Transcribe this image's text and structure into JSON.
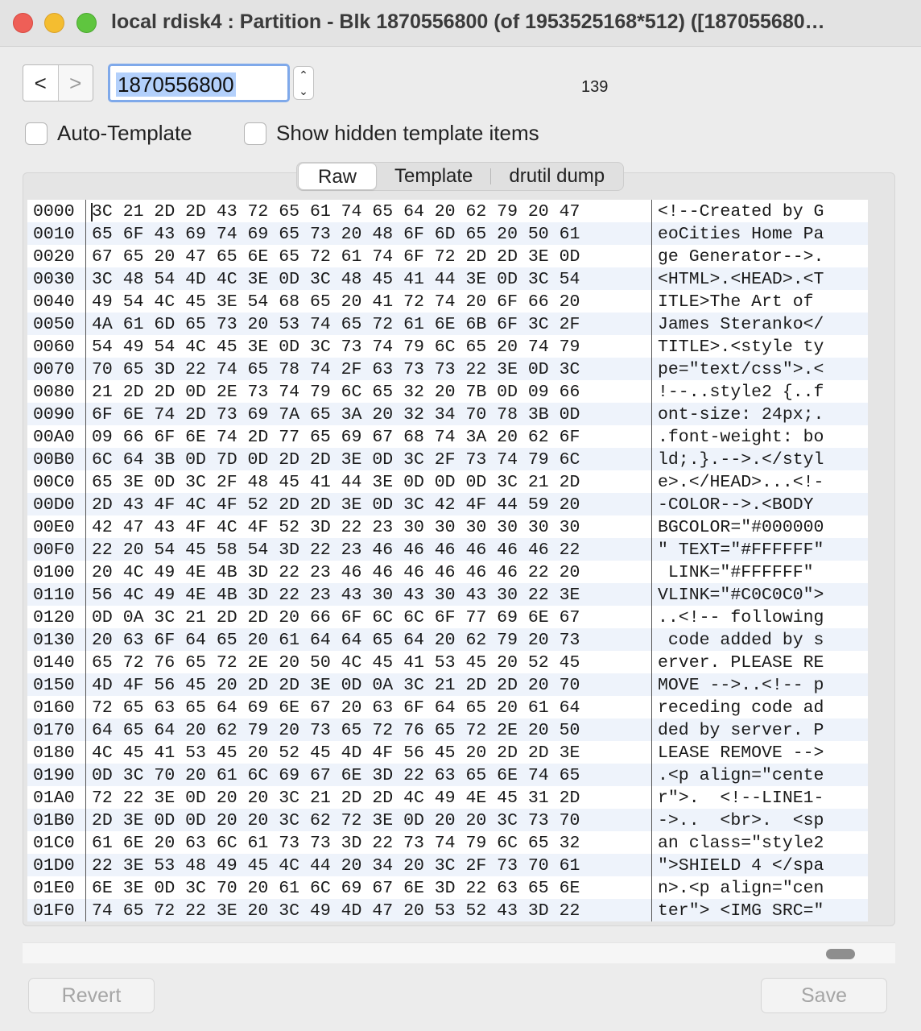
{
  "window": {
    "title": "local rdisk4 : Partition - Blk 1870556800 (of 1953525168*512) ([187055680…"
  },
  "toolbar": {
    "prev_label": "<",
    "next_label": ">",
    "block_value": "1870556800",
    "stepper_up": "⌃",
    "stepper_down": "⌄",
    "count": "139"
  },
  "options": {
    "auto_template": "Auto-Template",
    "show_hidden": "Show hidden template items"
  },
  "tabs": [
    {
      "label": "Raw",
      "active": true
    },
    {
      "label": "Template",
      "active": false
    },
    {
      "label": "drutil dump",
      "active": false
    }
  ],
  "hex_rows": [
    {
      "offset": "0000",
      "bytes": "3C 21 2D 2D 43 72 65 61 74 65 64 20 62 79 20 47",
      "ascii": "<!--Created by G"
    },
    {
      "offset": "0010",
      "bytes": "65 6F 43 69 74 69 65 73 20 48 6F 6D 65 20 50 61",
      "ascii": "eoCities Home Pa"
    },
    {
      "offset": "0020",
      "bytes": "67 65 20 47 65 6E 65 72 61 74 6F 72 2D 2D 3E 0D",
      "ascii": "ge Generator-->."
    },
    {
      "offset": "0030",
      "bytes": "3C 48 54 4D 4C 3E 0D 3C 48 45 41 44 3E 0D 3C 54",
      "ascii": "<HTML>.<HEAD>.<T"
    },
    {
      "offset": "0040",
      "bytes": "49 54 4C 45 3E 54 68 65 20 41 72 74 20 6F 66 20",
      "ascii": "ITLE>The Art of "
    },
    {
      "offset": "0050",
      "bytes": "4A 61 6D 65 73 20 53 74 65 72 61 6E 6B 6F 3C 2F",
      "ascii": "James Steranko</"
    },
    {
      "offset": "0060",
      "bytes": "54 49 54 4C 45 3E 0D 3C 73 74 79 6C 65 20 74 79",
      "ascii": "TITLE>.<style ty"
    },
    {
      "offset": "0070",
      "bytes": "70 65 3D 22 74 65 78 74 2F 63 73 73 22 3E 0D 3C",
      "ascii": "pe=\"text/css\">.<"
    },
    {
      "offset": "0080",
      "bytes": "21 2D 2D 0D 2E 73 74 79 6C 65 32 20 7B 0D 09 66",
      "ascii": "!--..style2 {..f"
    },
    {
      "offset": "0090",
      "bytes": "6F 6E 74 2D 73 69 7A 65 3A 20 32 34 70 78 3B 0D",
      "ascii": "ont-size: 24px;."
    },
    {
      "offset": "00A0",
      "bytes": "09 66 6F 6E 74 2D 77 65 69 67 68 74 3A 20 62 6F",
      "ascii": ".font-weight: bo"
    },
    {
      "offset": "00B0",
      "bytes": "6C 64 3B 0D 7D 0D 2D 2D 3E 0D 3C 2F 73 74 79 6C",
      "ascii": "ld;.}.-->.</styl"
    },
    {
      "offset": "00C0",
      "bytes": "65 3E 0D 3C 2F 48 45 41 44 3E 0D 0D 0D 3C 21 2D",
      "ascii": "e>.</HEAD>...<!-"
    },
    {
      "offset": "00D0",
      "bytes": "2D 43 4F 4C 4F 52 2D 2D 3E 0D 3C 42 4F 44 59 20",
      "ascii": "-COLOR-->.<BODY "
    },
    {
      "offset": "00E0",
      "bytes": "42 47 43 4F 4C 4F 52 3D 22 23 30 30 30 30 30 30",
      "ascii": "BGCOLOR=\"#000000"
    },
    {
      "offset": "00F0",
      "bytes": "22 20 54 45 58 54 3D 22 23 46 46 46 46 46 46 22",
      "ascii": "\" TEXT=\"#FFFFFF\""
    },
    {
      "offset": "0100",
      "bytes": "20 4C 49 4E 4B 3D 22 23 46 46 46 46 46 46 22 20",
      "ascii": " LINK=\"#FFFFFF\" "
    },
    {
      "offset": "0110",
      "bytes": "56 4C 49 4E 4B 3D 22 23 43 30 43 30 43 30 22 3E",
      "ascii": "VLINK=\"#C0C0C0\">"
    },
    {
      "offset": "0120",
      "bytes": "0D 0A 3C 21 2D 2D 20 66 6F 6C 6C 6F 77 69 6E 67",
      "ascii": "..<!-- following"
    },
    {
      "offset": "0130",
      "bytes": "20 63 6F 64 65 20 61 64 64 65 64 20 62 79 20 73",
      "ascii": " code added by s"
    },
    {
      "offset": "0140",
      "bytes": "65 72 76 65 72 2E 20 50 4C 45 41 53 45 20 52 45",
      "ascii": "erver. PLEASE RE"
    },
    {
      "offset": "0150",
      "bytes": "4D 4F 56 45 20 2D 2D 3E 0D 0A 3C 21 2D 2D 20 70",
      "ascii": "MOVE -->..<!-- p"
    },
    {
      "offset": "0160",
      "bytes": "72 65 63 65 64 69 6E 67 20 63 6F 64 65 20 61 64",
      "ascii": "receding code ad"
    },
    {
      "offset": "0170",
      "bytes": "64 65 64 20 62 79 20 73 65 72 76 65 72 2E 20 50",
      "ascii": "ded by server. P"
    },
    {
      "offset": "0180",
      "bytes": "4C 45 41 53 45 20 52 45 4D 4F 56 45 20 2D 2D 3E",
      "ascii": "LEASE REMOVE -->"
    },
    {
      "offset": "0190",
      "bytes": "0D 3C 70 20 61 6C 69 67 6E 3D 22 63 65 6E 74 65",
      "ascii": ".<p align=\"cente"
    },
    {
      "offset": "01A0",
      "bytes": "72 22 3E 0D 20 20 3C 21 2D 2D 4C 49 4E 45 31 2D",
      "ascii": "r\">.  <!--LINE1-"
    },
    {
      "offset": "01B0",
      "bytes": "2D 3E 0D 0D 20 20 3C 62 72 3E 0D 20 20 3C 73 70",
      "ascii": "->..  <br>.  <sp"
    },
    {
      "offset": "01C0",
      "bytes": "61 6E 20 63 6C 61 73 73 3D 22 73 74 79 6C 65 32",
      "ascii": "an class=\"style2"
    },
    {
      "offset": "01D0",
      "bytes": "22 3E 53 48 49 45 4C 44 20 34 20 3C 2F 73 70 61",
      "ascii": "\">SHIELD 4 </spa"
    },
    {
      "offset": "01E0",
      "bytes": "6E 3E 0D 3C 70 20 61 6C 69 67 6E 3D 22 63 65 6E",
      "ascii": "n>.<p align=\"cen"
    },
    {
      "offset": "01F0",
      "bytes": "74 65 72 22 3E 20 3C 49 4D 47 20 53 52 43 3D 22",
      "ascii": "ter\"> <IMG SRC=\""
    }
  ],
  "footer": {
    "revert_label": "Revert",
    "save_label": "Save"
  },
  "colors": {
    "selection": "#b3d0fb",
    "focus_ring": "#7fa9ea",
    "row_alt": "#eef3fb"
  }
}
